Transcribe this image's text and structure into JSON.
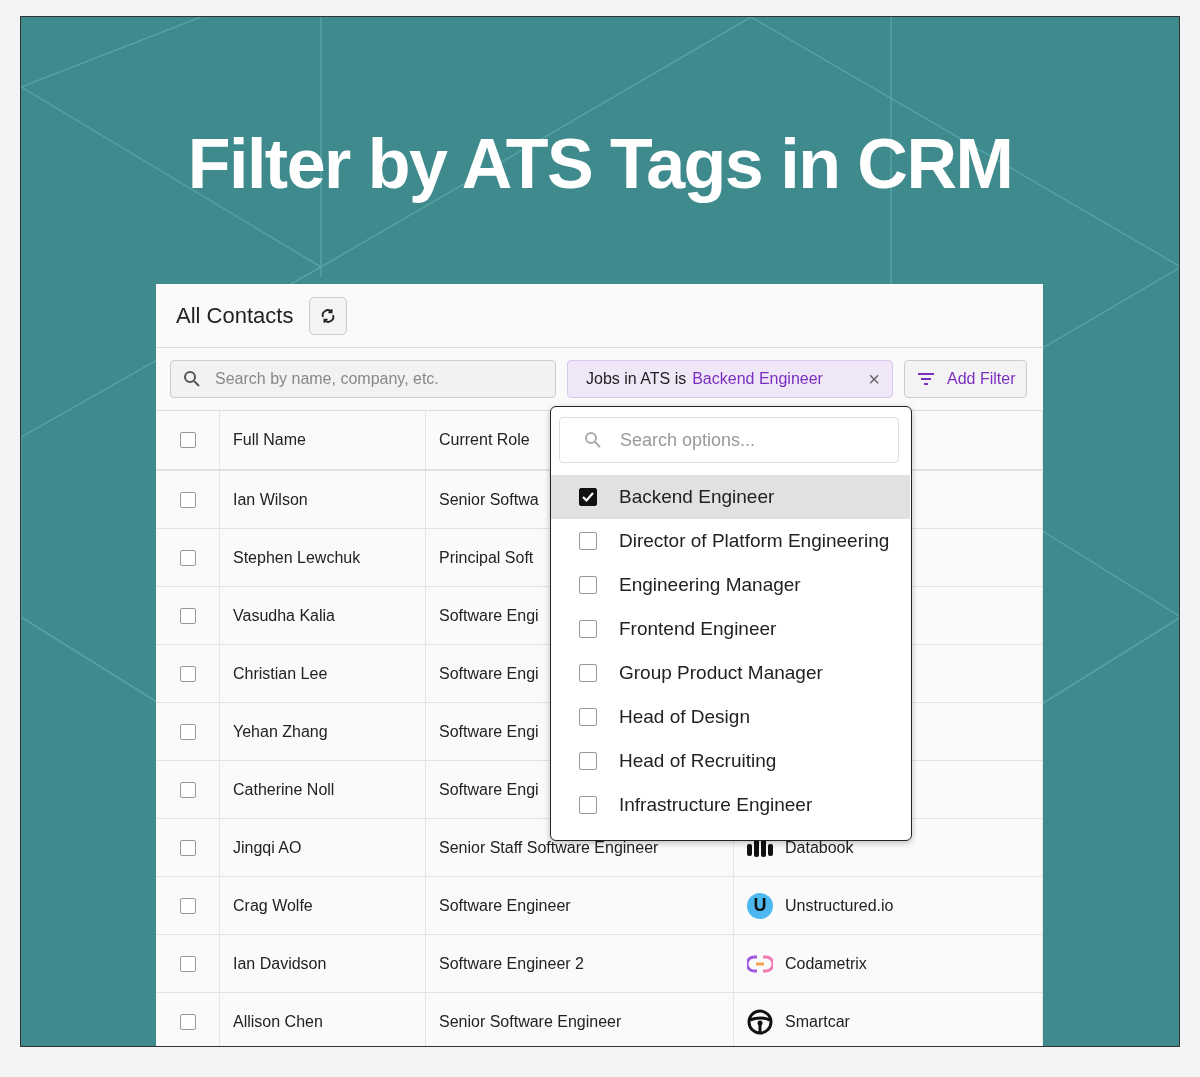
{
  "headline": "Filter by ATS Tags in CRM",
  "view": {
    "title": "All Contacts"
  },
  "search": {
    "placeholder": "Search by name, company, etc."
  },
  "filter_chip": {
    "field": "Jobs in ATS is",
    "value": "Backend Engineer",
    "remove": "×"
  },
  "add_filter": {
    "label": "Add Filter"
  },
  "table": {
    "all_checked": false,
    "columns": [
      "Full Name",
      "Current Role"
    ],
    "rows": [
      {
        "checked": false,
        "name": "Ian Wilson",
        "role": "Senior Softwa"
      },
      {
        "checked": false,
        "name": "Stephen Lewchuk",
        "role": "Principal Soft"
      },
      {
        "checked": false,
        "name": "Vasudha Kalia",
        "role": "Software Engi"
      },
      {
        "checked": false,
        "name": "Christian Lee",
        "role": "Software Engi"
      },
      {
        "checked": false,
        "name": "Yehan Zhang",
        "role": "Software Engi"
      },
      {
        "checked": false,
        "name": "Catherine Noll",
        "role": "Software Engi"
      },
      {
        "checked": false,
        "name": "Jingqi AO",
        "role": "Senior Staff Software Engineer",
        "company": {
          "name": "Databook",
          "kind": "bars"
        }
      },
      {
        "checked": false,
        "name": "Crag Wolfe",
        "role": "Software Engineer",
        "company": {
          "name": "Unstructured.io",
          "kind": "letter",
          "logo_text": "U"
        }
      },
      {
        "checked": false,
        "name": "Ian Davidson",
        "role": "Software Engineer 2",
        "company": {
          "name": "Codametrix",
          "kind": "link"
        }
      },
      {
        "checked": false,
        "name": "Allison Chen",
        "role": "Senior Software Engineer",
        "company": {
          "name": "Smartcar",
          "kind": "wheel"
        }
      }
    ]
  },
  "dropdown": {
    "placeholder": "Search options...",
    "options": [
      {
        "label": "Backend Engineer",
        "checked": true,
        "highlighted": true
      },
      {
        "label": "Director of Platform Engineering",
        "checked": false,
        "highlighted": false
      },
      {
        "label": "Engineering Manager",
        "checked": false,
        "highlighted": false
      },
      {
        "label": "Frontend Engineer",
        "checked": false,
        "highlighted": false
      },
      {
        "label": "Group Product Manager",
        "checked": false,
        "highlighted": false
      },
      {
        "label": "Head of Design",
        "checked": false,
        "highlighted": false
      },
      {
        "label": "Head of Recruiting",
        "checked": false,
        "highlighted": false
      },
      {
        "label": "Infrastructure Engineer",
        "checked": false,
        "highlighted": false
      }
    ]
  }
}
